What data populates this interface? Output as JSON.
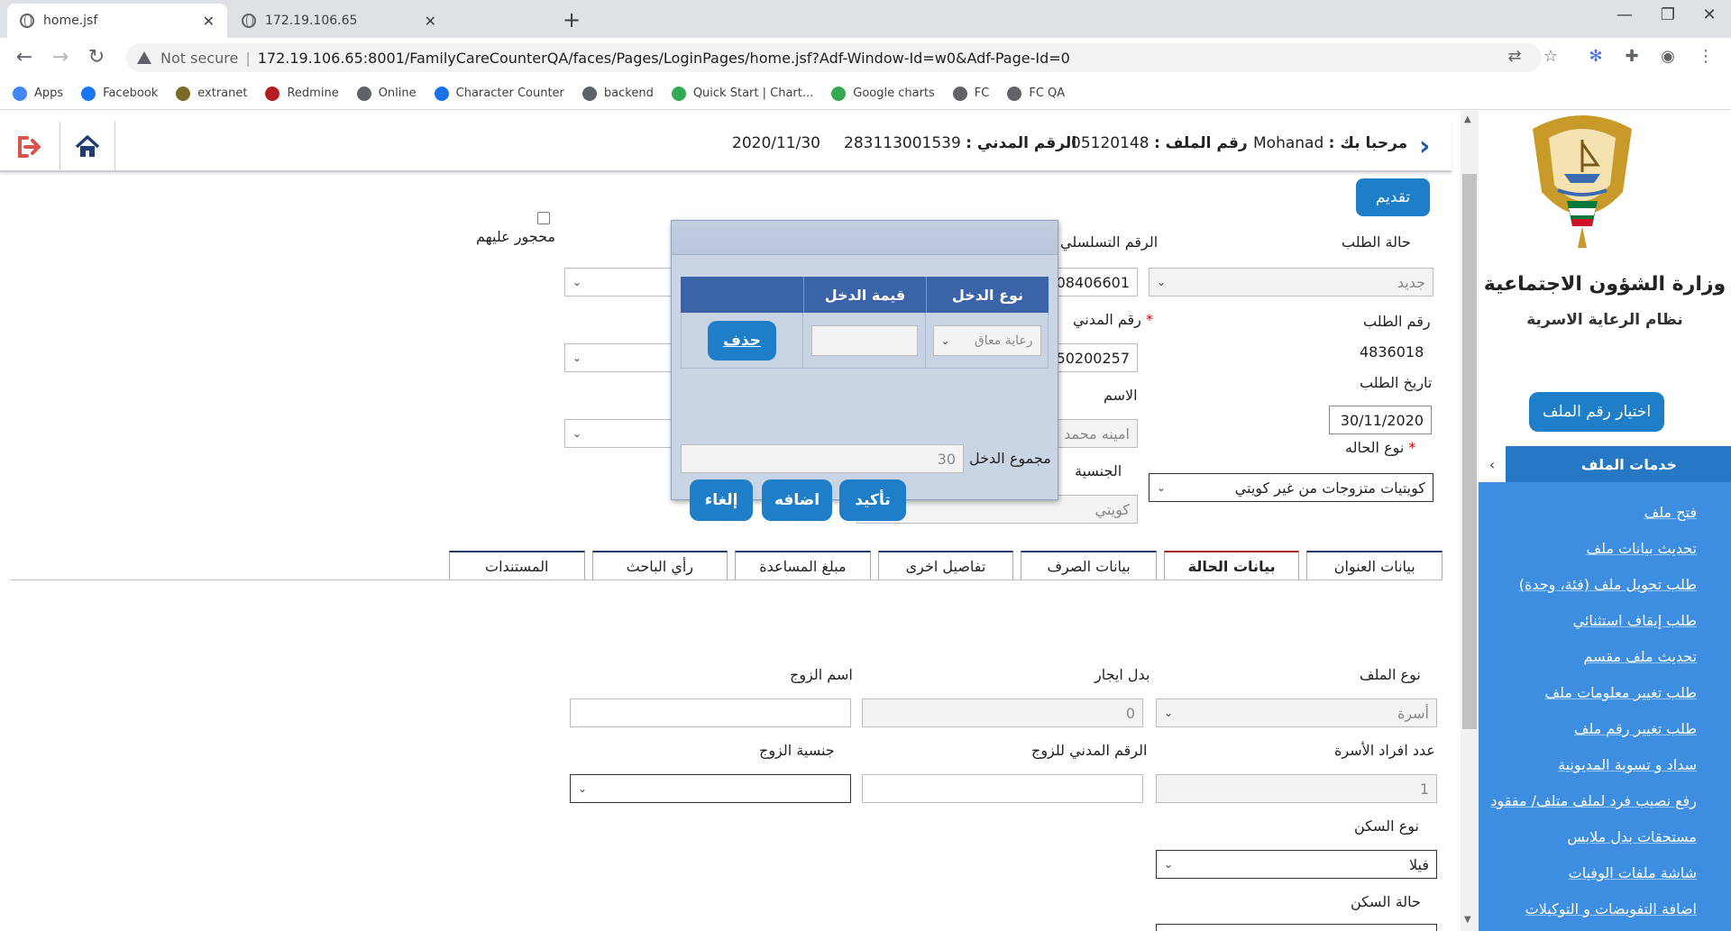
{
  "browser": {
    "tabs": [
      {
        "title": "home.jsf",
        "active": true
      },
      {
        "title": "172.19.106.65",
        "active": false
      }
    ],
    "address": {
      "security": "Not secure",
      "separator": "|",
      "url": "172.19.106.65:8001/FamilyCareCounterQA/faces/Pages/LoginPages/home.jsf?Adf-Window-Id=w0&Adf-Page-Id=0"
    },
    "bookmarks": [
      {
        "label": "Apps",
        "icon": "apps-grid-icon",
        "color": "#4285f4"
      },
      {
        "label": "Facebook",
        "icon": "facebook-icon",
        "color": "#1877f2"
      },
      {
        "label": "extranet",
        "icon": "emblem-icon",
        "color": "#7a6a2a"
      },
      {
        "label": "Redmine",
        "icon": "redmine-icon",
        "color": "#b32024"
      },
      {
        "label": "Online",
        "icon": "globe-icon",
        "color": "#5f6368"
      },
      {
        "label": "Character Counter",
        "icon": "counter-icon",
        "color": "#1a73e8"
      },
      {
        "label": "backend",
        "icon": "globe-icon",
        "color": "#5f6368"
      },
      {
        "label": "Quick Start  |  Chart...",
        "icon": "code-icon",
        "color": "#34a853"
      },
      {
        "label": "Google charts",
        "icon": "code-icon",
        "color": "#34a853"
      },
      {
        "label": "FC",
        "icon": "globe-icon",
        "color": "#5f6368"
      },
      {
        "label": "FC QA",
        "icon": "globe-icon",
        "color": "#5f6368"
      }
    ]
  },
  "header": {
    "welcome_label": "مرحبا بك :",
    "welcome_value": "Mohanad",
    "file_no_label": "رقم الملف :",
    "file_no_value": "05120148",
    "civil_id_label": "الرقم المدني :",
    "civil_id_value": "283113001539",
    "date": "2020/11/30"
  },
  "sidebar": {
    "ministry": "وزارة الشؤون الاجتماعية",
    "system": "نظام الرعاية الاسرية",
    "choose_file": "اختيار رقم الملف",
    "services_title": "خدمات الملف",
    "collapse_glyph": "‹",
    "items": [
      "فتح ملف",
      "تحديث بيانات ملف",
      "طلب تحويل ملف (فئة، وحدة)",
      "طلب إيقاف استثنائي",
      "تحديث ملف مقسم",
      "طلب تغيير معلومات ملف",
      "طلب تغيير رقم ملف",
      "سداد و تسوية المديونية",
      "رفع نصيب فرد لملف متلف/ مفقود",
      "مستحقات بدل ملابس",
      "شاشة ملفات الوفيات",
      "اضافة التفويضات و التوكيلات"
    ]
  },
  "form": {
    "submit": "تقديم",
    "request_status_label": "حالة الطلب",
    "request_status_value": "جديد",
    "serial_label": "الرقم التسلسلي",
    "serial_value": "08406601",
    "restricted_label": "محجور عليهم",
    "request_no_label": "رقم الطلب",
    "request_no_value": "4836018",
    "civil_label": "رقم المدني",
    "civil_value": "50200257",
    "request_date_label": "تاريخ الطلب",
    "request_date_value": "30/11/2020",
    "name_label": "الاسم",
    "name_value": "امينه محمد",
    "case_type_label": "نوع الحاله",
    "case_type_value": "كويتيات متزوجات من غير كويتي",
    "nationality_label": "الجنسية",
    "nationality_value": "كويتي",
    "required_mark": "*",
    "dropdown_glyph": "⌄"
  },
  "tabs": [
    {
      "label": "بيانات العنوان",
      "active": false
    },
    {
      "label": "بيانات الحالة",
      "active": true
    },
    {
      "label": "بيانات الصرف",
      "active": false
    },
    {
      "label": "تفاصيل اخرى",
      "active": false
    },
    {
      "label": "مبلغ المساعدة",
      "active": false
    },
    {
      "label": "رأي الباحث",
      "active": false
    },
    {
      "label": "المستندات",
      "active": false
    }
  ],
  "case": {
    "file_type_label": "نوع الملف",
    "file_type_value": "أسرة",
    "rent_label": "بدل ايجار",
    "rent_value": "0",
    "husband_name_label": "اسم الزوج",
    "husband_name_value": "",
    "family_count_label": "عدد افراد الأسرة",
    "family_count_value": "1",
    "husband_civil_label": "الرقم المدني للزوج",
    "husband_civil_value": "",
    "husband_nat_label": "جنسية الزوج",
    "husband_nat_value": "",
    "housing_type_label": "نوع السكن",
    "housing_type_value": "فيلا",
    "housing_status_label": "حالة السكن"
  },
  "modal": {
    "col_type": "نوع الدخل",
    "col_value": "قيمة الدخل",
    "row_type": "رعاية معاق",
    "row_value": "",
    "delete": "حذف",
    "total_label": "مجموع الدخل",
    "total_value": "30",
    "confirm": "تأكيد",
    "add": "اضافه",
    "cancel": "إلغاء"
  },
  "colors": {
    "primary_button": "#1e7ec8",
    "services_bg": "#3d8ee0",
    "table_header": "#3a63a8"
  }
}
